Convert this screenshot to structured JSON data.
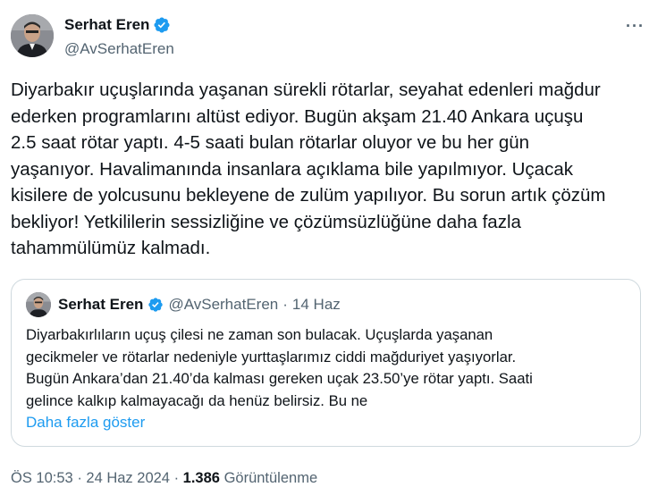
{
  "tweet": {
    "author_name": "Serhat Eren",
    "handle": "@AvSerhatEren",
    "more_icon": "more-icon",
    "text": "Diyarbakır uçuşlarında yaşanan sürekli rötarlar, seyahat edenleri mağdur\nederken programlarını altüst ediyor. Bugün akşam 21.40 Ankara uçuşu\n2.5 saat rötar yaptı.  4-5 saati bulan rötarlar oluyor ve bu her gün\nyaşanıyor. Havalimanında insanlara açıklama bile yapılmıyor. Uçacak\nkisilere de yolcusunu bekleyene de zulüm yapılıyor. Bu sorun artık çözüm\nbekliyor! Yetkililerin sessizliğine ve çözümsüzlüğüne daha fazla\ntahammülümüz kalmadı.",
    "verified_color": "#1d9bf0"
  },
  "quote": {
    "author_name": "Serhat Eren",
    "handle": "@AvSerhatEren",
    "separator": "·",
    "date": "14 Haz",
    "text": "Diyarbakırlıların uçuş çilesi ne zaman son bulacak. Uçuşlarda yaşanan\ngecikmeler ve rötarlar nedeniyle yurttaşlarımız ciddi mağduriyet yaşıyorlar.\nBugün Ankara’dan 21.40’da kalması gereken uçak 23.50’ye rötar yaptı. Saati\ngelince kalkıp kalmayacağı da henüz belirsiz. Bu ne",
    "show_more": "Daha fazla göster"
  },
  "footer": {
    "time": "ÖS 10:53",
    "sep1": "·",
    "date": "24 Haz 2024",
    "sep2": "·",
    "views_count": "1.386",
    "views_label": "Görüntülenme"
  }
}
